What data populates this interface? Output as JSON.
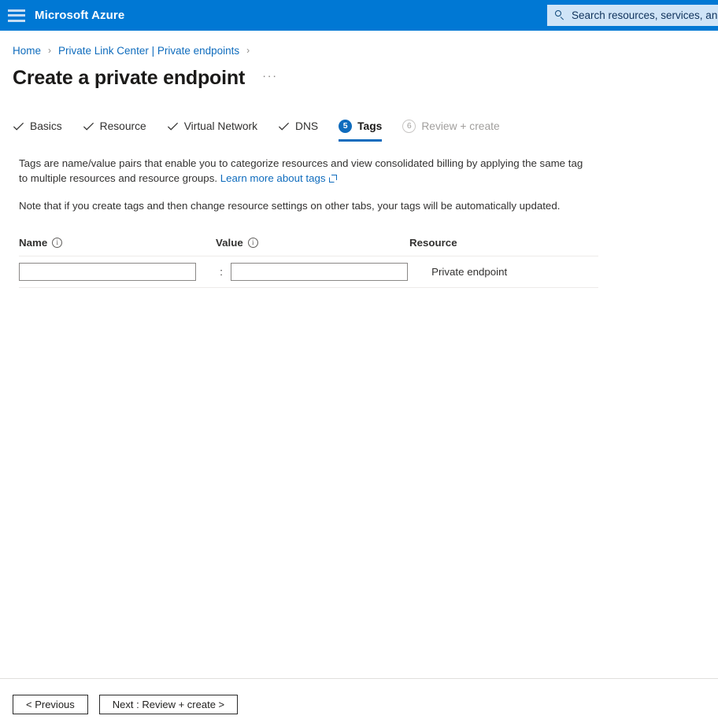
{
  "topbar": {
    "menu_icon": "hamburger-icon",
    "brand": "Microsoft Azure",
    "search": {
      "icon": "search-icon",
      "placeholder": "Search resources, services, and d"
    }
  },
  "breadcrumb": {
    "items": [
      {
        "label": "Home"
      },
      {
        "label": "Private Link Center | Private endpoints"
      }
    ],
    "separator": "›"
  },
  "page": {
    "title": "Create a private endpoint",
    "more_menu": "···"
  },
  "wizard": {
    "tabs": [
      {
        "label": "Basics",
        "state": "complete",
        "marker": "check"
      },
      {
        "label": "Resource",
        "state": "complete",
        "marker": "check"
      },
      {
        "label": "Virtual Network",
        "state": "complete",
        "marker": "check"
      },
      {
        "label": "DNS",
        "state": "complete",
        "marker": "check"
      },
      {
        "label": "Tags",
        "state": "active",
        "marker": "5"
      },
      {
        "label": "Review + create",
        "state": "disabled",
        "marker": "6"
      }
    ]
  },
  "content": {
    "description_part1": "Tags are name/value pairs that enable you to categorize resources and view consolidated billing by applying the same tag to multiple resources and resource groups.",
    "learn_more_label": "Learn more about tags",
    "learn_more_icon": "external-link-icon",
    "note": "Note that if you create tags and then change resource settings on other tabs, your tags will be automatically updated."
  },
  "tags_table": {
    "columns": [
      {
        "label": "Name",
        "info": true
      },
      {
        "label": "Value",
        "info": true
      },
      {
        "label": "Resource",
        "info": false
      }
    ],
    "separator": ":",
    "rows": [
      {
        "name_value": "",
        "name_placeholder": "",
        "value_value": "",
        "value_placeholder": "",
        "resource": "Private endpoint"
      }
    ]
  },
  "footer": {
    "previous_label": "< Previous",
    "next_label": "Next : Review + create >"
  },
  "colors": {
    "azure_blue": "#0078d4",
    "link_blue": "#0f6cbd",
    "search_bg": "#cfe4f7",
    "divider": "#e1dfdd",
    "disabled_text": "#a19f9d"
  }
}
